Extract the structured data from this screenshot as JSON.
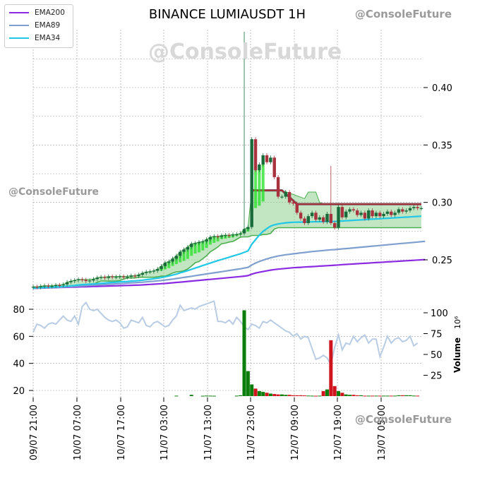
{
  "chart_data": {
    "type": "candlestick",
    "title": "BINANCE LUMIAUSDT 1H",
    "watermark": "@ConsoleFuture",
    "x_tick_labels": [
      "09/07 21:00",
      "10/07 07:00",
      "10/07 17:00",
      "11/07 03:00",
      "11/07 13:00",
      "11/07 23:00",
      "12/07 09:00",
      "12/07 19:00",
      "13/07 05:00"
    ],
    "legend": [
      {
        "name": "EMA200",
        "color": "#8a2be2"
      },
      {
        "name": "EMA89",
        "color": "#7f9fcf"
      },
      {
        "name": "EMA34",
        "color": "#1ec8e6"
      }
    ],
    "price_axis": {
      "ticks": [
        0.25,
        0.3,
        0.35,
        0.4
      ],
      "tick_labels": [
        "0.25",
        "0.30",
        "0.35",
        "0.40"
      ],
      "ylim": [
        0.223,
        0.44
      ]
    },
    "volume_axis": {
      "label": "Volume",
      "exponent": "10⁶",
      "ticks": [
        25,
        50,
        75,
        100
      ],
      "tick_labels": [
        "25",
        "50",
        "75",
        "100"
      ],
      "ylim": [
        0,
        110
      ]
    },
    "oscillator_axis": {
      "ticks": [
        20,
        40,
        60,
        80
      ],
      "tick_labels": [
        "20",
        "40",
        "60",
        "80"
      ],
      "ylim": [
        15,
        86
      ]
    },
    "colors": {
      "up": "#1a6b3c",
      "down": "#a8323e",
      "vol_up": "#0a7d0a",
      "vol_down": "#d0141e",
      "cloud": "#8fcf8f",
      "cloud_line": "#4caf50",
      "band": "#7a5a6a",
      "osc": "#b8cce4",
      "grid": "#9a9a9a"
    },
    "close": [
      0.2265,
      0.2262,
      0.227,
      0.2275,
      0.2268,
      0.2272,
      0.228,
      0.2278,
      0.2286,
      0.2305,
      0.2315,
      0.2322,
      0.233,
      0.2325,
      0.2315,
      0.232,
      0.2332,
      0.2345,
      0.235,
      0.2342,
      0.2355,
      0.2348,
      0.2352,
      0.2356,
      0.2348,
      0.2352,
      0.2362,
      0.2358,
      0.237,
      0.2385,
      0.2395,
      0.2398,
      0.2405,
      0.242,
      0.2445,
      0.2475,
      0.2485,
      0.251,
      0.2535,
      0.257,
      0.259,
      0.2612,
      0.264,
      0.2645,
      0.2655,
      0.266,
      0.2678,
      0.2698,
      0.2705,
      0.27,
      0.2712,
      0.2715,
      0.2712,
      0.272,
      0.2722,
      0.273,
      0.2768,
      0.2785,
      0.355,
      0.328,
      0.333,
      0.341,
      0.335,
      0.339,
      0.322,
      0.305,
      0.305,
      0.309,
      0.3,
      0.299,
      0.291,
      0.286,
      0.282,
      0.288,
      0.291,
      0.285,
      0.287,
      0.283,
      0.29,
      0.282,
      0.278,
      0.296,
      0.287,
      0.292,
      0.294,
      0.293,
      0.289,
      0.291,
      0.286,
      0.293,
      0.288,
      0.291,
      0.288,
      0.29,
      0.292,
      0.289,
      0.291,
      0.294,
      0.292,
      0.293,
      0.295,
      0.296,
      0.295,
      0.295
    ],
    "ema200": [
      0.2252,
      0.2253,
      0.2254,
      0.2255,
      0.2256,
      0.2257,
      0.2258,
      0.2259,
      0.226,
      0.2261,
      0.2262,
      0.2263,
      0.2264,
      0.2265,
      0.2266,
      0.2267,
      0.2268,
      0.2269,
      0.227,
      0.2271,
      0.2272,
      0.2273,
      0.2274,
      0.2275,
      0.2276,
      0.2277,
      0.2278,
      0.2279,
      0.228,
      0.2282,
      0.2284,
      0.2286,
      0.2288,
      0.229,
      0.2292,
      0.2294,
      0.2297,
      0.23,
      0.2303,
      0.2306,
      0.2309,
      0.2312,
      0.2315,
      0.2318,
      0.2321,
      0.2324,
      0.2327,
      0.233,
      0.2333,
      0.2336,
      0.2339,
      0.2342,
      0.2345,
      0.2348,
      0.2351,
      0.2354,
      0.2358,
      0.2362,
      0.2375,
      0.2385,
      0.2392,
      0.2398,
      0.2404,
      0.241,
      0.2415,
      0.2419,
      0.2422,
      0.2425,
      0.2428,
      0.2431,
      0.2433,
      0.2435,
      0.2437,
      0.2439,
      0.2441,
      0.2443,
      0.2445,
      0.2447,
      0.2449,
      0.2451,
      0.2453,
      0.2455,
      0.2458,
      0.246,
      0.2462,
      0.2464,
      0.2466,
      0.2468,
      0.247,
      0.2472,
      0.2474,
      0.2476,
      0.2478,
      0.248,
      0.2482,
      0.2484,
      0.2486,
      0.2488,
      0.249,
      0.2492,
      0.2494,
      0.2496,
      0.2498,
      0.25,
      0.2502
    ],
    "ema89": [
      0.2252,
      0.2253,
      0.2255,
      0.2256,
      0.2257,
      0.2258,
      0.226,
      0.2261,
      0.2263,
      0.2265,
      0.2267,
      0.2269,
      0.2271,
      0.2273,
      0.2275,
      0.2277,
      0.2279,
      0.2281,
      0.2283,
      0.2285,
      0.2287,
      0.2289,
      0.2291,
      0.2293,
      0.2295,
      0.2297,
      0.2299,
      0.2301,
      0.2303,
      0.2305,
      0.2308,
      0.2311,
      0.2314,
      0.2317,
      0.232,
      0.2324,
      0.2328,
      0.2332,
      0.2337,
      0.2342,
      0.2347,
      0.2352,
      0.2357,
      0.2362,
      0.2367,
      0.2372,
      0.2377,
      0.2382,
      0.2387,
      0.2392,
      0.2397,
      0.2402,
      0.2407,
      0.2412,
      0.2417,
      0.2422,
      0.2428,
      0.2434,
      0.2455,
      0.2472,
      0.2485,
      0.2497,
      0.2508,
      0.2518,
      0.2526,
      0.2533,
      0.2539,
      0.2544,
      0.2548,
      0.2552,
      0.2556,
      0.256,
      0.2564,
      0.2568,
      0.2572,
      0.2575,
      0.2578,
      0.2581,
      0.2584,
      0.2587,
      0.2589,
      0.2592,
      0.2595,
      0.2598,
      0.2601,
      0.2604,
      0.2607,
      0.261,
      0.2613,
      0.2616,
      0.2619,
      0.2622,
      0.2625,
      0.2628,
      0.2631,
      0.2634,
      0.2637,
      0.264,
      0.2643,
      0.2646,
      0.2649,
      0.2652,
      0.2655,
      0.2658,
      0.2661
    ],
    "ema34": [
      0.2255,
      0.2256,
      0.2258,
      0.2259,
      0.226,
      0.2262,
      0.2264,
      0.2266,
      0.2268,
      0.2271,
      0.2274,
      0.2277,
      0.2281,
      0.2284,
      0.2286,
      0.2288,
      0.229,
      0.2293,
      0.2296,
      0.2298,
      0.2301,
      0.2303,
      0.2306,
      0.2308,
      0.231,
      0.2312,
      0.2315,
      0.2317,
      0.232,
      0.2323,
      0.2327,
      0.2331,
      0.2335,
      0.234,
      0.2345,
      0.2352,
      0.2359,
      0.2367,
      0.2376,
      0.2386,
      0.2396,
      0.2406,
      0.2417,
      0.2428,
      0.2439,
      0.245,
      0.2461,
      0.2472,
      0.2483,
      0.2493,
      0.2503,
      0.2513,
      0.2523,
      0.2533,
      0.2543,
      0.2553,
      0.2565,
      0.2578,
      0.2635,
      0.2675,
      0.2715,
      0.2748,
      0.2772,
      0.2793,
      0.2805,
      0.2812,
      0.2818,
      0.2822,
      0.2825,
      0.2827,
      0.2828,
      0.2828,
      0.2829,
      0.283,
      0.2831,
      0.2832,
      0.2832,
      0.2833,
      0.2834,
      0.2834,
      0.2834,
      0.2837,
      0.2838,
      0.284,
      0.2842,
      0.2844,
      0.2846,
      0.2848,
      0.285,
      0.2852,
      0.2854,
      0.2856,
      0.2858,
      0.286,
      0.2862,
      0.2864,
      0.2866,
      0.2868,
      0.287,
      0.2872,
      0.2874,
      0.2876,
      0.2878,
      0.288
    ],
    "oscillator": [
      63,
      69,
      68,
      66,
      69,
      70,
      69,
      72,
      75,
      72,
      71,
      75,
      69,
      82,
      85,
      80,
      79,
      80,
      77,
      74,
      72,
      71,
      72,
      70,
      66,
      67,
      72,
      71,
      70,
      74,
      68,
      67,
      70,
      71,
      69,
      67,
      68,
      72,
      75,
      83,
      79,
      80,
      81,
      80,
      82,
      83,
      84,
      85,
      86,
      71,
      71,
      70,
      72,
      69,
      74,
      71,
      67,
      65,
      69,
      68,
      66,
      71,
      70,
      72,
      70,
      68,
      66,
      64,
      63,
      60,
      62,
      58,
      60,
      59,
      51,
      43,
      44,
      46,
      44,
      39,
      52,
      61,
      50,
      55,
      54,
      60,
      56,
      59,
      61,
      55,
      58,
      58,
      45,
      52,
      60,
      55,
      58,
      59,
      56,
      57,
      60,
      53,
      55
    ],
    "volume": [
      0,
      0,
      0,
      0,
      0,
      0,
      0,
      0,
      0,
      0,
      0,
      0,
      0,
      0,
      0,
      0,
      0,
      0,
      0,
      0,
      0,
      0,
      0,
      0,
      0,
      0,
      0,
      0,
      0,
      0,
      0,
      0,
      0,
      0,
      0,
      0,
      0,
      0,
      0.5,
      0,
      0,
      0,
      1.5,
      0,
      0,
      0.4,
      0.6,
      0.5,
      0.4,
      0,
      0,
      0,
      0,
      0,
      0.5,
      1,
      103,
      30,
      14,
      9,
      6,
      5,
      4,
      3,
      2.5,
      2,
      2,
      1.5,
      1.5,
      1,
      1,
      1,
      0.8,
      0.6,
      0.5,
      0.4,
      0.5,
      6,
      8,
      67,
      12,
      6,
      4,
      2,
      1.5,
      1.5,
      1,
      1,
      0.5,
      0.5,
      0.5,
      0.5,
      0.5,
      0.5,
      0.5,
      0.5,
      0.5,
      1,
      1,
      1,
      1,
      0.6,
      0.5
    ]
  }
}
